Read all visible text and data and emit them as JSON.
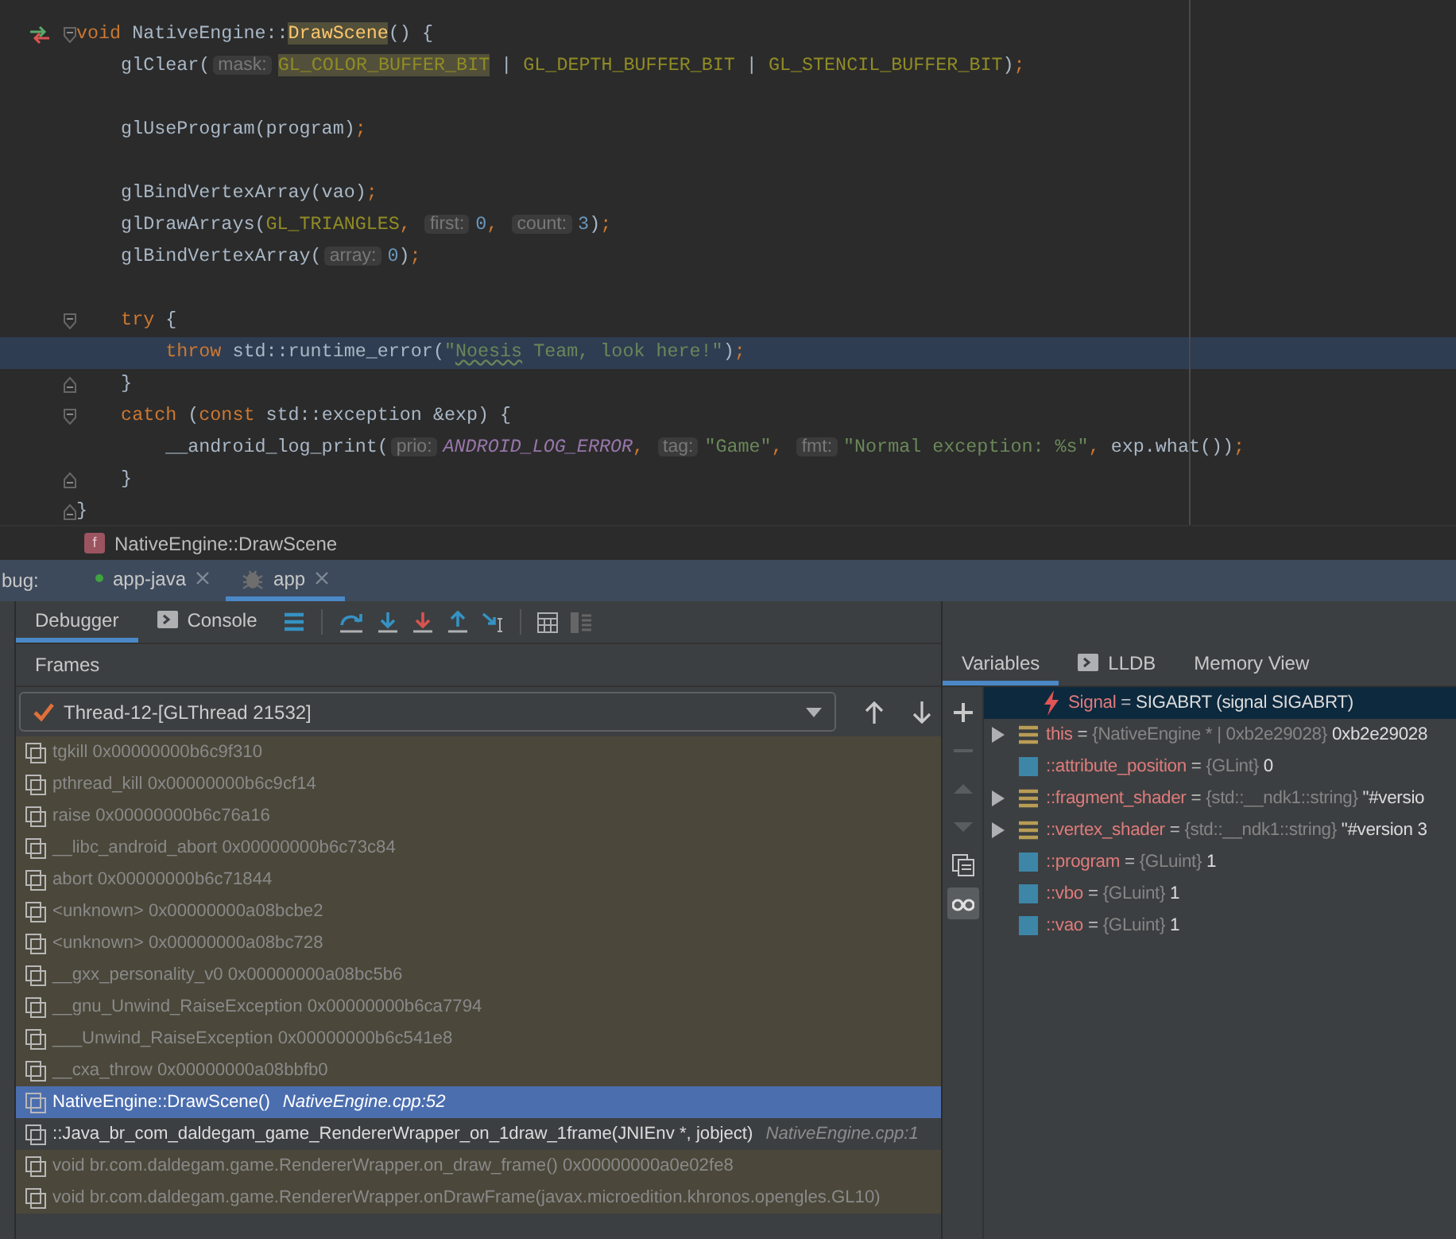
{
  "editor": {
    "lines": [
      {
        "current": false,
        "kind": "plain"
      },
      {
        "current": false,
        "kind": "entry",
        "tokens": [
          {
            "text": "void ",
            "kind": "kw"
          },
          {
            "text": "NativeEngine::",
            "kind": "plain"
          },
          {
            "text": "DrawScene",
            "kind": "fn",
            "highlight": true
          },
          {
            "text": "() {",
            "kind": "plain"
          }
        ]
      },
      {
        "current": false,
        "kind": "plain",
        "tokens": [
          {
            "text": "    glClear(",
            "kind": "plain"
          },
          {
            "text": "mask:",
            "kind": "hint"
          },
          {
            "text": "GL_COLOR_BUFFER_BIT",
            "kind": "macro",
            "highlight": true
          },
          {
            "text": " | ",
            "kind": "plain"
          },
          {
            "text": "GL_DEPTH_BUFFER_BIT",
            "kind": "macro"
          },
          {
            "text": " | ",
            "kind": "plain"
          },
          {
            "text": "GL_STENCIL_BUFFER_BIT",
            "kind": "macro"
          },
          {
            "text": ")",
            "kind": "plain"
          },
          {
            "text": ";",
            "kind": "kw"
          }
        ]
      },
      {
        "current": false,
        "kind": "plain"
      },
      {
        "current": false,
        "kind": "plain",
        "tokens": [
          {
            "text": "    glUseProgram(program)",
            "kind": "plain"
          },
          {
            "text": ";",
            "kind": "kw"
          }
        ]
      },
      {
        "current": false,
        "kind": "plain"
      },
      {
        "current": false,
        "kind": "plain",
        "tokens": [
          {
            "text": "    glBindVertexArray(vao)",
            "kind": "plain"
          },
          {
            "text": ";",
            "kind": "kw"
          }
        ]
      },
      {
        "current": false,
        "kind": "plain",
        "tokens": [
          {
            "text": "    glDrawArrays(",
            "kind": "plain"
          },
          {
            "text": "GL_TRIANGLES",
            "kind": "macro"
          },
          {
            "text": ", ",
            "kind": "kw"
          },
          {
            "text": "first:",
            "kind": "hint"
          },
          {
            "text": "0",
            "kind": "num"
          },
          {
            "text": ", ",
            "kind": "kw"
          },
          {
            "text": "count:",
            "kind": "hint"
          },
          {
            "text": "3",
            "kind": "num"
          },
          {
            "text": ")",
            "kind": "plain"
          },
          {
            "text": ";",
            "kind": "kw"
          }
        ]
      },
      {
        "current": false,
        "kind": "plain",
        "tokens": [
          {
            "text": "    glBindVertexArray(",
            "kind": "plain"
          },
          {
            "text": "array:",
            "kind": "hint"
          },
          {
            "text": "0",
            "kind": "num"
          },
          {
            "text": ")",
            "kind": "plain"
          },
          {
            "text": ";",
            "kind": "kw"
          }
        ]
      },
      {
        "current": false,
        "kind": "plain"
      },
      {
        "current": false,
        "kind": "block-start",
        "tokens": [
          {
            "text": "    try ",
            "kind": "kw"
          },
          {
            "text": "{",
            "kind": "plain"
          }
        ]
      },
      {
        "current": true,
        "kind": "plain",
        "tokens": [
          {
            "text": "        throw ",
            "kind": "kw"
          },
          {
            "text": "std::runtime_error(",
            "kind": "plain"
          },
          {
            "text": "\"",
            "kind": "str"
          },
          {
            "text": "Noesis",
            "kind": "str",
            "typo": true
          },
          {
            "text": " Team, look here!\"",
            "kind": "str"
          },
          {
            "text": ")",
            "kind": "plain"
          },
          {
            "text": ";",
            "kind": "kw"
          }
        ]
      },
      {
        "current": false,
        "kind": "block-end",
        "tokens": [
          {
            "text": "    }",
            "kind": "plain"
          }
        ]
      },
      {
        "current": false,
        "kind": "block-start",
        "tokens": [
          {
            "text": "    catch ",
            "kind": "kw"
          },
          {
            "text": "(",
            "kind": "plain"
          },
          {
            "text": "const ",
            "kind": "kw"
          },
          {
            "text": "std::exception &exp) {",
            "kind": "plain"
          }
        ]
      },
      {
        "current": false,
        "kind": "plain",
        "tokens": [
          {
            "text": "        __android_log_print(",
            "kind": "plain"
          },
          {
            "text": "prio:",
            "kind": "hint"
          },
          {
            "text": "ANDROID_LOG_ERROR",
            "kind": "const"
          },
          {
            "text": ", ",
            "kind": "kw"
          },
          {
            "text": "tag:",
            "kind": "hint"
          },
          {
            "text": "\"Game\"",
            "kind": "str"
          },
          {
            "text": ", ",
            "kind": "kw"
          },
          {
            "text": "fmt:",
            "kind": "hint"
          },
          {
            "text": "\"Normal exception: %s\"",
            "kind": "str"
          },
          {
            "text": ", ",
            "kind": "kw"
          },
          {
            "text": "exp.what())",
            "kind": "plain"
          },
          {
            "text": ";",
            "kind": "kw"
          }
        ]
      },
      {
        "current": false,
        "kind": "block-end",
        "tokens": [
          {
            "text": "    }",
            "kind": "plain"
          }
        ]
      },
      {
        "current": false,
        "kind": "block-end",
        "tokens": [
          {
            "text": "}",
            "kind": "plain"
          }
        ]
      }
    ]
  },
  "breadcrumb": {
    "badge": "f",
    "text": "NativeEngine::DrawScene"
  },
  "debug": {
    "label": "bug:",
    "sessions": [
      {
        "label": "app-java",
        "kind": "java",
        "selected": false
      },
      {
        "label": "app",
        "kind": "native",
        "selected": true
      }
    ],
    "tabs": [
      {
        "label": "Debugger",
        "kind": "debugger",
        "selected": true
      },
      {
        "label": "Console",
        "kind": "console",
        "selected": false
      }
    ]
  },
  "frames": {
    "title": "Frames",
    "thread": "Thread-12-[GLThread 21532]",
    "items": [
      {
        "name": "tgkill 0x00000000b6c9f310",
        "kind": "library",
        "selected": false
      },
      {
        "name": "pthread_kill 0x00000000b6c9cf14",
        "kind": "library",
        "selected": false
      },
      {
        "name": "raise 0x00000000b6c76a16",
        "kind": "library",
        "selected": false
      },
      {
        "name": "__libc_android_abort 0x00000000b6c73c84",
        "kind": "library",
        "selected": false
      },
      {
        "name": "abort 0x00000000b6c71844",
        "kind": "library",
        "selected": false
      },
      {
        "name": "<unknown> 0x00000000a08bcbe2",
        "kind": "library",
        "selected": false
      },
      {
        "name": "<unknown> 0x00000000a08bc728",
        "kind": "library",
        "selected": false
      },
      {
        "name": "__gxx_personality_v0 0x00000000a08bc5b6",
        "kind": "library",
        "selected": false
      },
      {
        "name": "__gnu_Unwind_RaiseException 0x00000000b6ca7794",
        "kind": "library",
        "selected": false
      },
      {
        "name": "___Unwind_RaiseException 0x00000000b6c541e8",
        "kind": "library",
        "selected": false
      },
      {
        "name": "__cxa_throw 0x00000000a08bbfb0",
        "kind": "library",
        "selected": false
      },
      {
        "name": "NativeEngine::DrawScene()",
        "location": "NativeEngine.cpp:52",
        "kind": "app",
        "selected": true
      },
      {
        "name": "::Java_br_com_daldegam_game_RendererWrapper_on_1draw_1frame(JNIEnv *, jobject)",
        "location": "NativeEngine.cpp:1",
        "kind": "app",
        "selected": false
      },
      {
        "name": "void br.com.daldegam.game.RendererWrapper.on_draw_frame() 0x00000000a0e02fe8",
        "kind": "library",
        "selected": false
      },
      {
        "name": "void br.com.daldegam.game.RendererWrapper.onDrawFrame(javax.microedition.khronos.opengles.GL10)",
        "kind": "library",
        "selected": false
      }
    ]
  },
  "variables": {
    "tabs": [
      {
        "label": "Variables",
        "kind": "plain",
        "selected": true
      },
      {
        "label": "LLDB",
        "kind": "console",
        "selected": false
      },
      {
        "label": "Memory View",
        "kind": "plain",
        "selected": false
      }
    ],
    "items": [
      {
        "kind": "signal",
        "expandable": false,
        "selected": true,
        "name": "Signal",
        "eq": " = ",
        "value": "SIGABRT (signal SIGABRT)"
      },
      {
        "kind": "struct",
        "expandable": true,
        "selected": false,
        "name": "this",
        "eq": " = ",
        "type": "{NativeEngine * | 0xb2e29028}",
        "value": "0xb2e29028"
      },
      {
        "kind": "primitive",
        "expandable": false,
        "selected": false,
        "name": "::attribute_position",
        "eq": " = ",
        "type": "{GLint}",
        "value": "0"
      },
      {
        "kind": "struct",
        "expandable": true,
        "selected": false,
        "name": "::fragment_shader",
        "eq": " = ",
        "type": "{std::__ndk1::string}",
        "value": "\"#versio"
      },
      {
        "kind": "struct",
        "expandable": true,
        "selected": false,
        "name": "::vertex_shader",
        "eq": " = ",
        "type": "{std::__ndk1::string}",
        "value": "\"#version 3"
      },
      {
        "kind": "primitive",
        "expandable": false,
        "selected": false,
        "name": "::program",
        "eq": " = ",
        "type": "{GLuint}",
        "value": "1"
      },
      {
        "kind": "primitive",
        "expandable": false,
        "selected": false,
        "name": "::vbo",
        "eq": " = ",
        "type": "{GLuint}",
        "value": "1"
      },
      {
        "kind": "primitive",
        "expandable": false,
        "selected": false,
        "name": "::vao",
        "eq": " = ",
        "type": "{GLuint}",
        "value": "1"
      }
    ]
  }
}
